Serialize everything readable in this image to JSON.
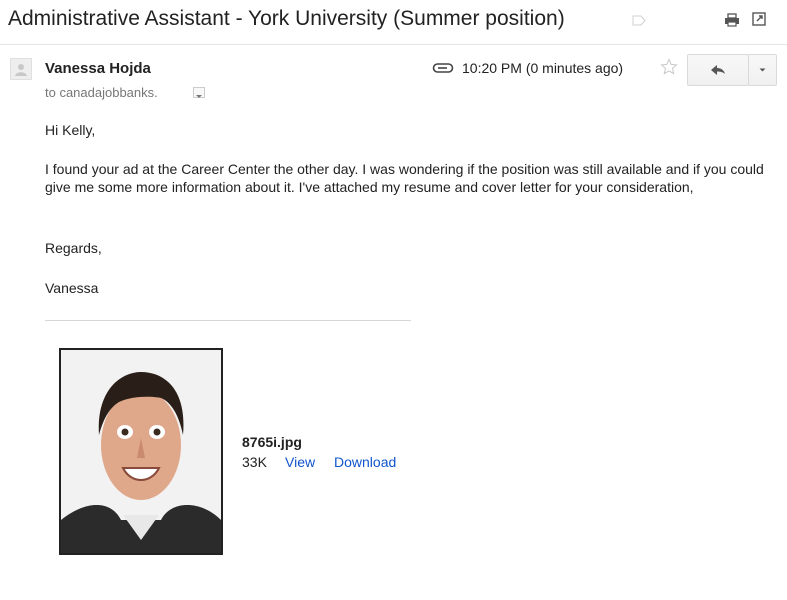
{
  "email": {
    "subject": "Administrative Assistant - York University (Summer position)",
    "sender": "Vanessa Hojda",
    "to": "to canadajobbanks.",
    "time": "10:20 PM (0 minutes ago)",
    "greeting": "Hi Kelly,",
    "body": "I found your ad at the Career Center the other day. I was wondering if the position was still available and if you could give me some more information about it. I've attached my resume and cover letter for your consideration,",
    "closing": "Regards,",
    "signature": "Vanessa"
  },
  "attachment": {
    "filename": "8765i.jpg",
    "size": "33K",
    "view_label": "View",
    "download_label": "Download"
  },
  "icons": {
    "label": "label-icon",
    "print": "print-icon",
    "new_window": "new-window-icon",
    "avatar": "avatar",
    "attachment": "paperclip-icon",
    "star": "star-icon",
    "reply": "reply-icon",
    "more": "chevron-down-icon"
  },
  "colors": {
    "link": "#1155cc",
    "muted": "#777777",
    "text": "#222222"
  }
}
